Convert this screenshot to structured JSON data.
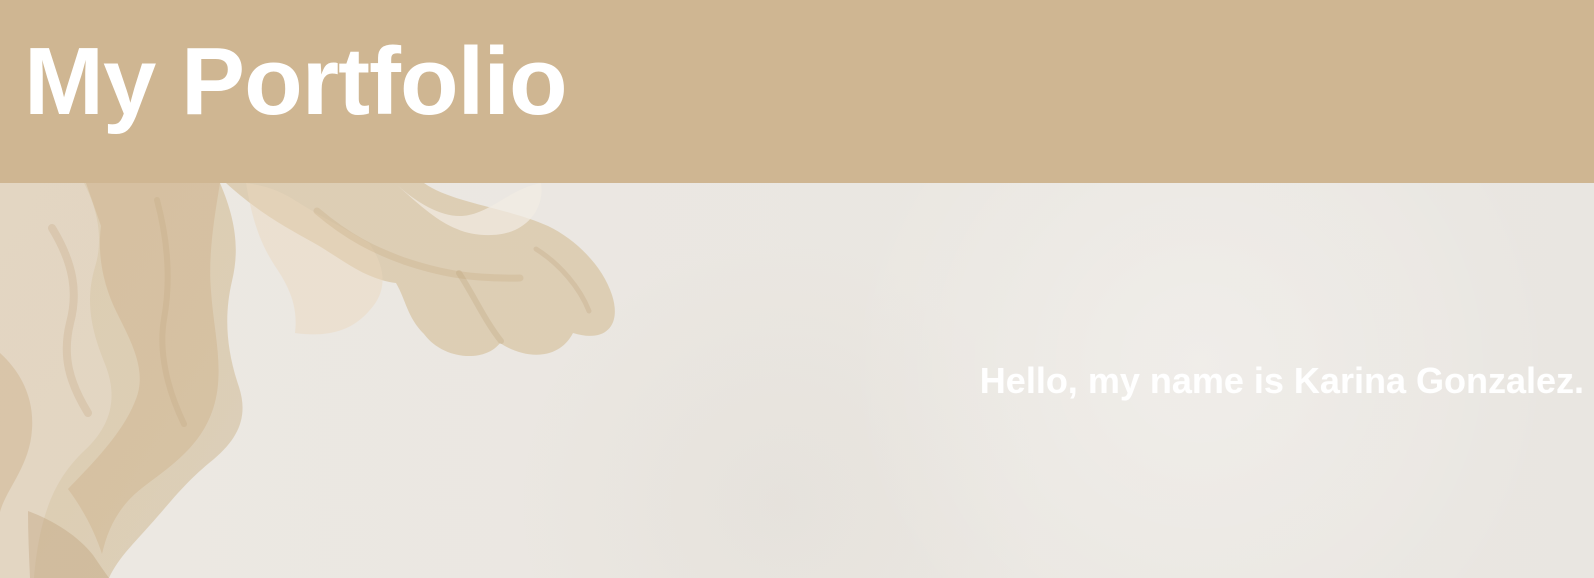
{
  "header": {
    "title": "My Portfolio"
  },
  "hero": {
    "greeting": "Hello, my name is Karina Gonzalez."
  },
  "colors": {
    "header_background": "#cfb692",
    "hero_background": "#ebe7e1",
    "text": "#ffffff",
    "texture_accent": "#d6c3a2"
  },
  "icons": {
    "hero_decoration": "beige-painted-texture-icon"
  }
}
